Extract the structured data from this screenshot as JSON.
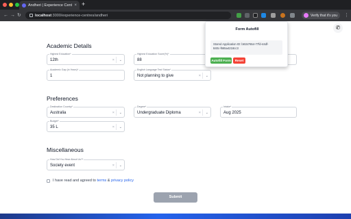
{
  "browser": {
    "tab_title": "Andheri | Experience Centre",
    "tab_close": "×",
    "new_tab": "+",
    "url_host": "localhost",
    "url_path": ":3000/experience-centres/andheri",
    "back": "←",
    "forward": "→",
    "reload": "↻",
    "verify_label": "Verify that it's you",
    "window_controls": {
      "close": "#ff5f57",
      "min": "#febc2e",
      "max": "#28c840"
    }
  },
  "popup": {
    "title": "Form Autofill",
    "stored_label": "Stored Application ID: b8157654-77fd-44df-",
    "stored_id_cont": "840c-f665a4218cc3",
    "autofill_button": "Autofill Form",
    "reset_button": "Reset",
    "colors": {
      "autofill": "#4caf50",
      "reset": "#f44336"
    }
  },
  "sections": {
    "academic": "Academic Details",
    "preferences": "Preferences",
    "misc": "Miscellaneous"
  },
  "fields": {
    "education": {
      "label": "Highest Education*",
      "value": "12th"
    },
    "score": {
      "label": "Highest Education Score(%)*",
      "value": "88"
    },
    "gap": {
      "label": "Academic Gap (in Years)*",
      "value": "1"
    },
    "english": {
      "label": "English Language Test Status*",
      "value": "Not planning to give"
    },
    "country": {
      "label": "Destination Country*",
      "value": "Australia"
    },
    "degree": {
      "label": "Degree*",
      "value": "Undergraduate Diploma"
    },
    "intake": {
      "label": "Intake*",
      "value": "Aug 2025"
    },
    "budget": {
      "label": "Budget*",
      "value": "35 L"
    },
    "source": {
      "label": "How Did You Hear About Us?*",
      "value": "Society event"
    }
  },
  "icons": {
    "clear": "×",
    "chevron": "⌄",
    "phone": "✆"
  },
  "agreement": {
    "prefix": "I have read and agreed to ",
    "terms": "terms",
    "and": " & ",
    "privacy": "privacy policy"
  },
  "submit_label": "Submit"
}
